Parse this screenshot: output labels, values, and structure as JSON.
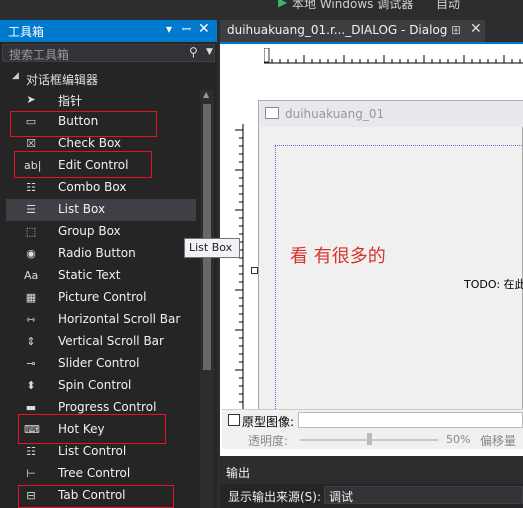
{
  "toolbar": {
    "run_target": "本地 Windows 调试器",
    "run_mode": "自动"
  },
  "toolbox": {
    "title": "工具箱",
    "search_placeholder": "搜索工具箱",
    "group": "对话框编辑器",
    "items": [
      {
        "label": "指针",
        "icon": "pointer-icon"
      },
      {
        "label": "Button",
        "icon": "button-icon"
      },
      {
        "label": "Check Box",
        "icon": "checkbox-icon"
      },
      {
        "label": "Edit Control",
        "icon": "edit-control-icon"
      },
      {
        "label": "Combo Box",
        "icon": "combobox-icon"
      },
      {
        "label": "List Box",
        "icon": "listbox-icon"
      },
      {
        "label": "Group Box",
        "icon": "groupbox-icon"
      },
      {
        "label": "Radio Button",
        "icon": "radio-icon"
      },
      {
        "label": "Static Text",
        "icon": "static-text-icon"
      },
      {
        "label": "Picture Control",
        "icon": "picture-icon"
      },
      {
        "label": "Horizontal Scroll Bar",
        "icon": "hscroll-icon"
      },
      {
        "label": "Vertical Scroll Bar",
        "icon": "vscroll-icon"
      },
      {
        "label": "Slider Control",
        "icon": "slider-icon"
      },
      {
        "label": "Spin Control",
        "icon": "spin-icon"
      },
      {
        "label": "Progress Control",
        "icon": "progress-icon"
      },
      {
        "label": "Hot Key",
        "icon": "hotkey-icon"
      },
      {
        "label": "List Control",
        "icon": "listcontrol-icon"
      },
      {
        "label": "Tree Control",
        "icon": "tree-icon"
      },
      {
        "label": "Tab Control",
        "icon": "tab-icon"
      }
    ],
    "selected": "List Box"
  },
  "tooltip": "List Box",
  "document": {
    "tab_title": "duihuakuang_01.r..._DIALOG - Dialog",
    "dialog_title": "duihuakuang_01",
    "handwritten": "看  有很多的",
    "todo": "TODO: 在此"
  },
  "prototype": {
    "label": "原型图像:",
    "opacity_label": "透明度:",
    "opacity_value": "50%",
    "offset_label": "偏移量"
  },
  "opacity": {
    "level": 0.5
  },
  "output": {
    "title": "输出",
    "source_label": "显示输出来源(S):",
    "source_value": "调试"
  },
  "colors": {
    "accent": "#007acc",
    "highlight": "#e81123",
    "handwriting": "#d9322b"
  }
}
